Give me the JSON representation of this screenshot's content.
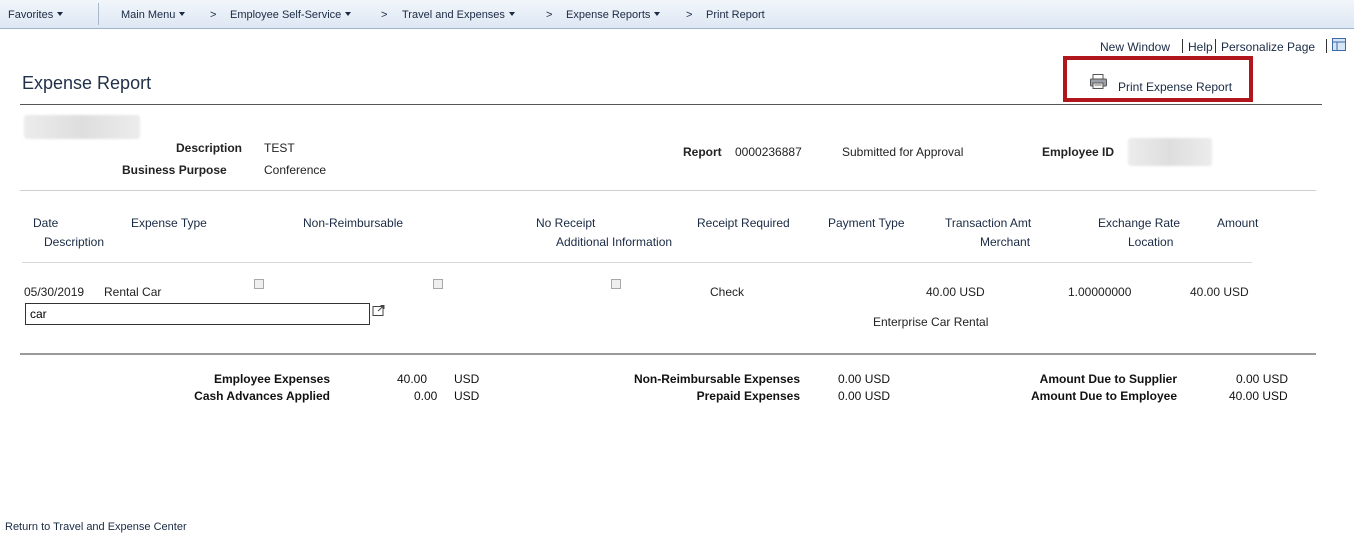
{
  "nav": {
    "favorites": "Favorites",
    "main_menu": "Main Menu",
    "breadcrumb": [
      {
        "label": "Employee Self-Service",
        "has_menu": true
      },
      {
        "label": "Travel and Expenses",
        "has_menu": true
      },
      {
        "label": "Expense Reports",
        "has_menu": true
      },
      {
        "label": "Print Report",
        "has_menu": false
      }
    ],
    "separator": ">"
  },
  "header_links": {
    "new_window": "New Window",
    "help": "Help",
    "personalize": "Personalize Page"
  },
  "page_title": "Expense Report",
  "print_action": {
    "label": "Print Expense Report",
    "icon": "printer-icon",
    "highlight_color": "#b0161b"
  },
  "report": {
    "description_label": "Description",
    "description_value": "TEST",
    "business_purpose_label": "Business Purpose",
    "business_purpose_value": "Conference",
    "report_label": "Report",
    "report_number": "0000236887",
    "status": "Submitted for Approval",
    "employee_id_label": "Employee ID"
  },
  "lines": {
    "headers": {
      "date": "Date",
      "description": "Description",
      "expense_type": "Expense Type",
      "non_reimbursable": "Non-Reimbursable",
      "no_receipt": "No Receipt",
      "additional_info": "Additional Information",
      "receipt_required": "Receipt Required",
      "payment_type": "Payment Type",
      "transaction_amt": "Transaction Amt",
      "merchant": "Merchant",
      "exchange_rate": "Exchange Rate",
      "location": "Location",
      "amount": "Amount"
    },
    "rows": [
      {
        "date": "05/30/2019",
        "expense_type": "Rental Car",
        "description": "car",
        "payment_type": "Check",
        "transaction_amt": "40.00 USD",
        "exchange_rate": "1.00000000",
        "amount": "40.00 USD",
        "merchant": "Enterprise Car Rental"
      }
    ]
  },
  "totals": {
    "employee_expenses_label": "Employee Expenses",
    "employee_expenses_amt": "40.00",
    "employee_expenses_cur": "USD",
    "cash_advances_label": "Cash Advances Applied",
    "cash_advances_amt": "0.00",
    "cash_advances_cur": "USD",
    "non_reimb_label": "Non-Reimbursable Expenses",
    "non_reimb_value": "0.00 USD",
    "prepaid_label": "Prepaid Expenses",
    "prepaid_value": "0.00 USD",
    "due_supplier_label": "Amount Due to Supplier",
    "due_supplier_value": "0.00 USD",
    "due_employee_label": "Amount Due to Employee",
    "due_employee_value": "40.00 USD"
  },
  "footer": {
    "return_link": "Return to Travel and Expense Center"
  }
}
